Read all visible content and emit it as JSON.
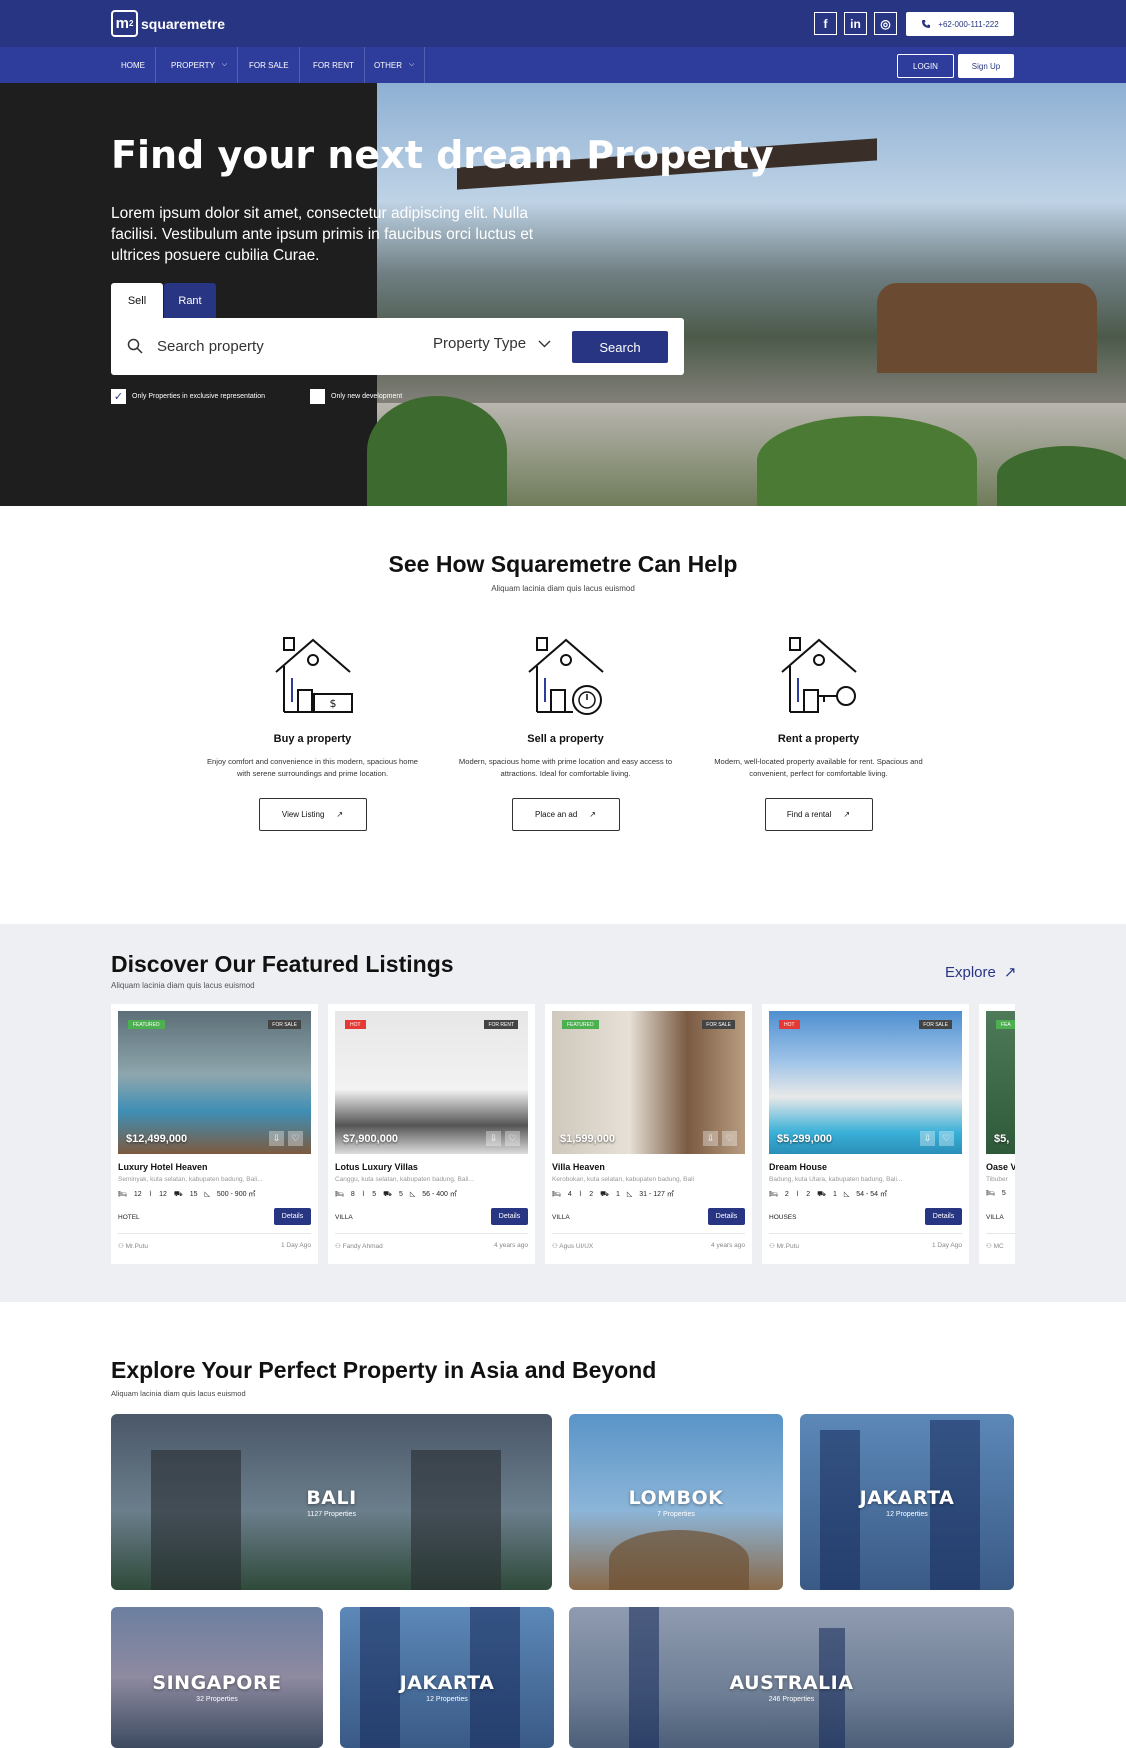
{
  "brand": {
    "logo_mark": "m",
    "logo_sup": "2",
    "name": "squaremetre"
  },
  "topbar": {
    "social": [
      {
        "label": "f",
        "icon": "facebook-icon"
      },
      {
        "label": "in",
        "icon": "linkedin-icon"
      },
      {
        "label": "◎",
        "icon": "instagram-icon"
      }
    ],
    "phone": "+62-000-111-222"
  },
  "nav": {
    "items": [
      "HOME",
      "PROPERTY",
      "FOR SALE",
      "FOR RENT",
      "OTHER"
    ],
    "login": "LOGIN",
    "signup": "Sign Up"
  },
  "hero": {
    "title": "Find your next dream Property",
    "description": "Lorem ipsum dolor sit amet, consectetur adipiscing elit. Nulla facilisi. Vestibulum ante ipsum primis in faucibus orci luctus et ultrices posuere cubilia Curae.",
    "tabs": [
      "Sell",
      "Rant"
    ],
    "search_placeholder": "Search property",
    "property_type": "Property Type",
    "search_button": "Search",
    "checkbox_exclusive": "Only Properties in exclusive representation",
    "checkbox_new": "Only new development"
  },
  "help": {
    "title": "See How Squaremetre Can Help",
    "subtitle": "Aliquam lacinia diam quis lacus euismod",
    "cards": [
      {
        "title": "Buy a property",
        "desc": "Enjoy comfort and convenience in this modern, spacious home with serene surroundings and prime location.",
        "button": "View Listing"
      },
      {
        "title": "Sell a property",
        "desc": "Modern, spacious home with prime location and easy access to attractions. Ideal for comfortable living.",
        "button": "Place an ad"
      },
      {
        "title": "Rent a property",
        "desc": "Modern, well-located property available for rent. Spacious and convenient, perfect for comfortable living.",
        "button": "Find a rental"
      }
    ]
  },
  "featured": {
    "title": "Discover Our Featured Listings",
    "subtitle": "Aliquam lacinia diam quis lacus euismod",
    "explore": "Explore",
    "listings": [
      {
        "badge": "FEATURED",
        "badge_color": "#4caf50",
        "status": "FOR SALE",
        "price": "$12,499,000",
        "name": "Luxury Hotel Heaven",
        "location": "Seminyak, kuta selatan, kabupaten badung, Bali...",
        "beds": "12",
        "baths": "12",
        "cars": "15",
        "area": "500 - 900 ㎡",
        "type": "HOTEL",
        "details": "Details",
        "agent": "Mr.Putu",
        "time": "1 Day Ago"
      },
      {
        "badge": "HOT",
        "badge_color": "#e53935",
        "status": "FOR RENT",
        "price": "$7,900,000",
        "name": "Lotus Luxury Villas",
        "location": "Canggu, kuta selatan, kabupaten badung, Bali...",
        "beds": "8",
        "baths": "5",
        "cars": "5",
        "area": "56 - 400 ㎡",
        "type": "VILLA",
        "details": "Details",
        "agent": "Fandy Ahmad",
        "time": "4 years ago"
      },
      {
        "badge": "FEATURED",
        "badge_color": "#4caf50",
        "status": "FOR SALE",
        "price": "$1,599,000",
        "name": "Villa Heaven",
        "location": "Kerobokan, kuta selatan, kabupaten badung, Bali",
        "beds": "4",
        "baths": "2",
        "cars": "1",
        "area": "31 - 127 ㎡",
        "type": "VILLA",
        "details": "Details",
        "agent": "Agus UI/UX",
        "time": "4 years ago"
      },
      {
        "badge": "HOT",
        "badge_color": "#e53935",
        "status": "FOR SALE",
        "price": "$5,299,000",
        "name": "Dream House",
        "location": "Badung, kuta Utara, kabupaten badung, Bali...",
        "beds": "2",
        "baths": "2",
        "cars": "1",
        "area": "54 - 54 ㎡",
        "type": "HOUSES",
        "details": "Details",
        "agent": "Mr.Putu",
        "time": "1 Day Ago"
      },
      {
        "badge": "FEA",
        "badge_color": "#4caf50",
        "status": "",
        "price": "$5,",
        "name": "Oase V",
        "location": "Tibuber",
        "beds": "5",
        "baths": "",
        "cars": "",
        "area": "",
        "type": "VILLA",
        "details": "",
        "agent": "MC",
        "time": ""
      }
    ]
  },
  "explore": {
    "title": "Explore Your Perfect Property in Asia and Beyond",
    "subtitle": "Aliquam lacinia diam quis lacus euismod",
    "cities": [
      {
        "name": "BALI",
        "count": "1127 Properties"
      },
      {
        "name": "LOMBOK",
        "count": "7 Properties"
      },
      {
        "name": "JAKARTA",
        "count": "12 Properties"
      },
      {
        "name": "SINGAPORE",
        "count": "32 Properties"
      },
      {
        "name": "JAKARTA",
        "count": "12 Properties"
      },
      {
        "name": "AUSTRALIA",
        "count": "246 Properties"
      }
    ]
  },
  "colors": {
    "brand": "#283582",
    "nav": "#2e3c9c",
    "featured_bg": "#eeeff3"
  }
}
